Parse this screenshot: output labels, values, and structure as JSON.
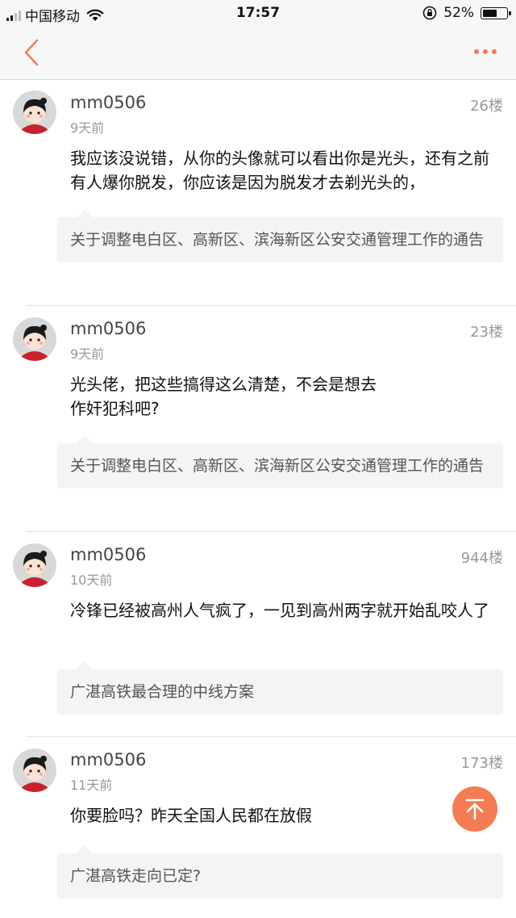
{
  "status_bar": {
    "carrier": "中国移动",
    "time": "17:57",
    "battery": "52%",
    "battery_level": 0.52,
    "icons": [
      "signal-icon",
      "wifi-icon",
      "rotation-lock-icon",
      "battery-icon"
    ]
  },
  "nav": {
    "back_icon": "chevron-left-icon",
    "more_icon": "more-dots-icon",
    "accent_color": "#f27b4e"
  },
  "posts": [
    {
      "username": "mm0506",
      "floor": "26楼",
      "time": "9天前",
      "content": "我应该没说错，从你的头像就可以看出你是光头，还有之前有人爆你脱发，你应该是因为脱发才去剃光头的，",
      "quote": "关于调整电白区、高新区、滨海新区公安交通管理工作的通告"
    },
    {
      "username": "mm0506",
      "floor": "23楼",
      "time": "9天前",
      "content": "光头佬，把这些搞得这么清楚，不会是想去\n作奸犯科吧?",
      "quote": "关于调整电白区、高新区、滨海新区公安交通管理工作的通告"
    },
    {
      "username": "mm0506",
      "floor": "944楼",
      "time": "10天前",
      "content": "冷锋已经被高州人气疯了，一见到高州两字就开始乱咬人了",
      "quote": "广湛高铁最合理的中线方案"
    },
    {
      "username": "mm0506",
      "floor": "173楼",
      "time": "11天前",
      "content": "你要脸吗？昨天全国人民都在放假",
      "quote": "广湛高铁走向已定?"
    }
  ],
  "scroll_top_button": {
    "icon": "scroll-to-top-icon",
    "color": "#f47c55"
  }
}
